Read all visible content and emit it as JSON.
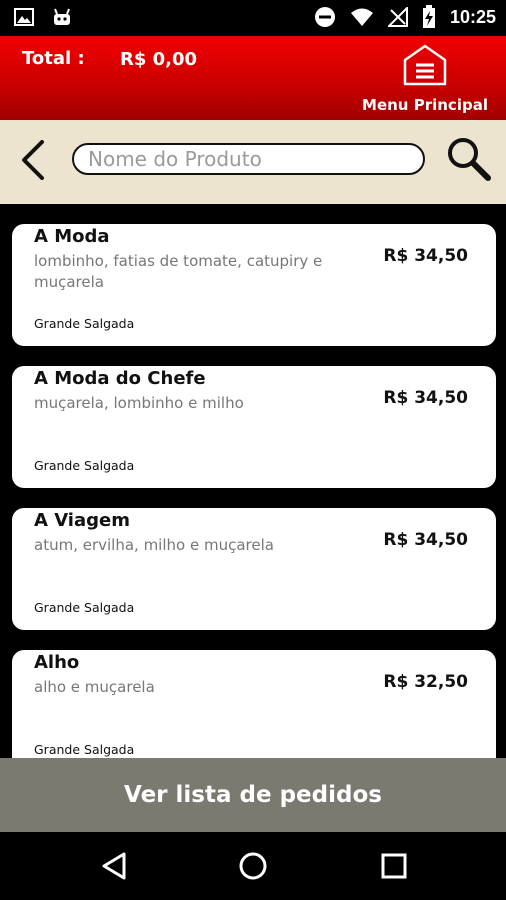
{
  "status_bar": {
    "time": "10:25",
    "left_icons": [
      "image-icon",
      "android-icon"
    ],
    "right_icons": [
      "do-not-disturb-icon",
      "wifi-icon",
      "no-signal-icon",
      "battery-charging-icon"
    ]
  },
  "header": {
    "total_label": "Total :",
    "total_value": "R$ 0,00",
    "menu_label": "Menu Principal",
    "background_color": "#d40000"
  },
  "search": {
    "placeholder": "Nome do Produto",
    "value": ""
  },
  "products": [
    {
      "name": "A Moda",
      "description": "lombinho, fatias de tomate, catupiry e muçarela",
      "price": "R$ 34,50",
      "category": "Grande Salgada"
    },
    {
      "name": "A Moda do Chefe",
      "description": "muçarela, lombinho e milho",
      "price": "R$ 34,50",
      "category": "Grande Salgada"
    },
    {
      "name": "A Viagem",
      "description": "atum, ervilha, milho e muçarela",
      "price": "R$ 34,50",
      "category": "Grande Salgada"
    },
    {
      "name": "Alho",
      "description": "alho e muçarela",
      "price": "R$ 32,50",
      "category": "Grande Salgada"
    }
  ],
  "footer": {
    "button_label": "Ver lista de pedidos"
  },
  "nav_bar": {
    "icons": [
      "back-triangle-icon",
      "home-circle-icon",
      "recents-square-icon"
    ]
  }
}
